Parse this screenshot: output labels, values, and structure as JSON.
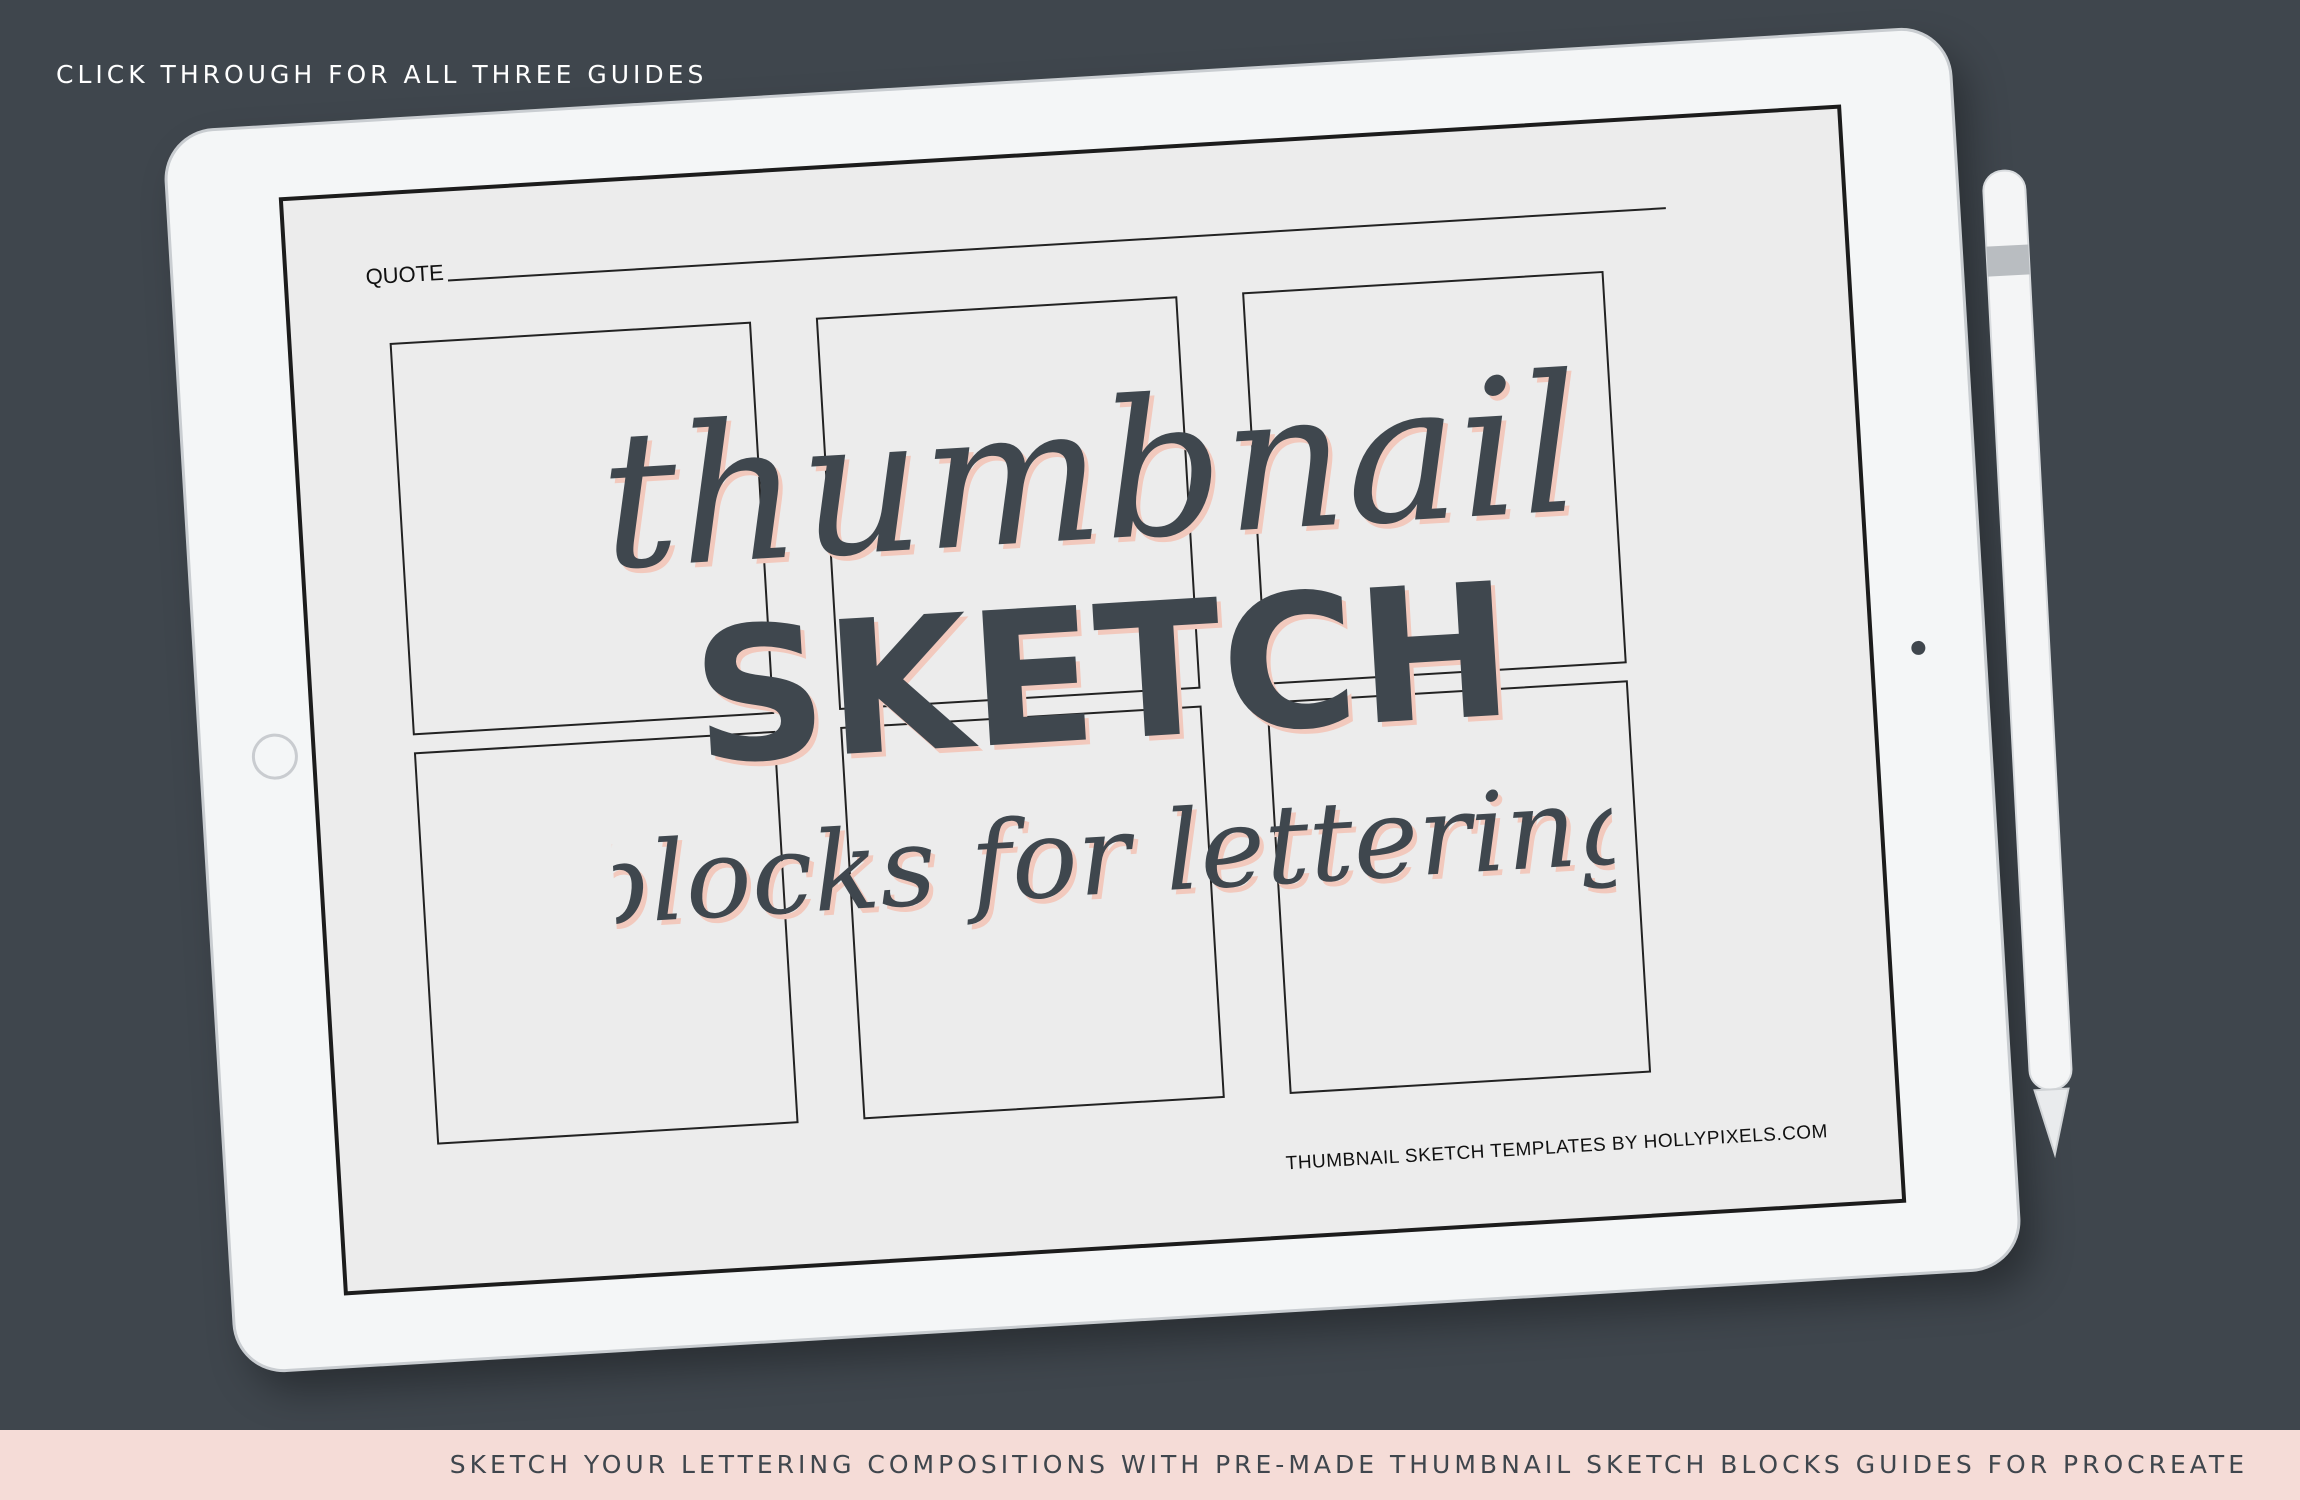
{
  "top_caption": "CLICK THROUGH FOR ALL THREE GUIDES",
  "bottom_caption": "SKETCH YOUR LETTERING COMPOSITIONS WITH PRE-MADE THUMBNAIL SKETCH BLOCKS GUIDES FOR PROCREATE",
  "screen": {
    "quote_label": "QUOTE",
    "credit": "THUMBNAIL SKETCH TEMPLATES BY HOLLYPIXELS.COM",
    "lettering": {
      "line1": "thumbnail",
      "line2": "SKETCH",
      "line3": "blocks for lettering"
    }
  },
  "colors": {
    "background": "#3f464d",
    "band": "#f5dcd7",
    "lettering": "#3f474e",
    "lettering_shadow": "#f2c9bd"
  }
}
